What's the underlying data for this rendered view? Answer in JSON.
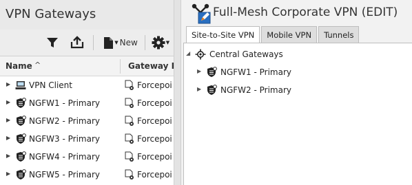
{
  "left_panel": {
    "title": "VPN Gateways",
    "toolbar": {
      "filter_icon": "filter-icon",
      "export_icon": "export-icon",
      "new_label": "New",
      "settings_icon": "gear-icon"
    },
    "columns": {
      "name": "Name",
      "type": "Gateway Pr"
    },
    "rows": [
      {
        "name": "VPN Client",
        "icon": "vpn-client-icon",
        "type": "Forcepoi"
      },
      {
        "name": "NGFW1 - Primary",
        "icon": "firewall-gateway-icon",
        "type": "Forcepoi"
      },
      {
        "name": "NGFW2 - Primary",
        "icon": "firewall-gateway-icon",
        "type": "Forcepoi"
      },
      {
        "name": "NGFW3 - Primary",
        "icon": "firewall-gateway-icon",
        "type": "Forcepoi"
      },
      {
        "name": "NGFW4 - Primary",
        "icon": "firewall-gateway-icon",
        "type": "Forcepoi"
      },
      {
        "name": "NGFW5 - Primary",
        "icon": "firewall-gateway-icon",
        "type": "Forcepoi"
      }
    ]
  },
  "right_panel": {
    "title": "Full-Mesh Corporate VPN (EDIT)",
    "tabs": [
      "Site-to-Site VPN",
      "Mobile VPN",
      "Tunnels"
    ],
    "active_tab": "Site-to-Site VPN",
    "tree": {
      "root": {
        "label": "Central Gateways",
        "icon": "central-gateways-icon"
      },
      "children": [
        {
          "label": "NGFW1 - Primary",
          "icon": "firewall-gateway-icon"
        },
        {
          "label": "NGFW2 - Primary",
          "icon": "firewall-gateway-icon"
        }
      ]
    }
  },
  "colors": {
    "title_bar": "#e9e9e9",
    "accent_orange": "#e8821e",
    "vpn_blue": "#2a6fc0"
  }
}
